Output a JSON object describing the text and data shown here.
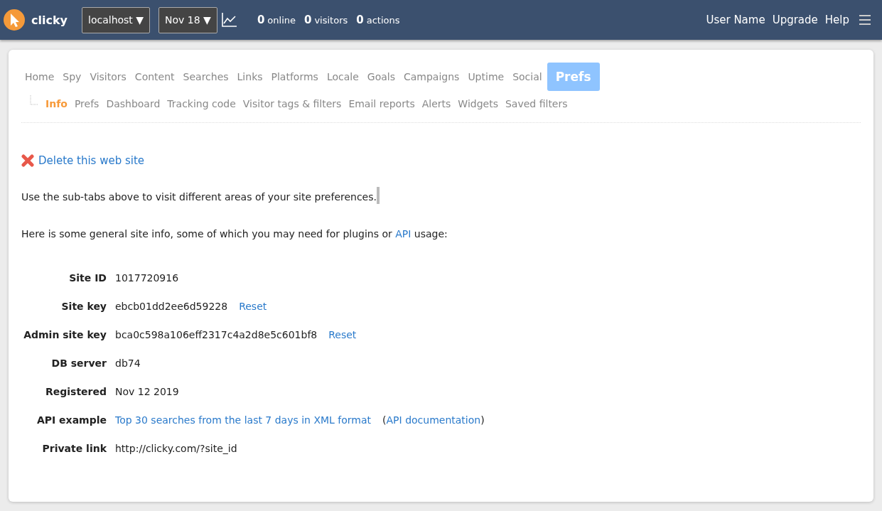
{
  "header": {
    "brand": "clicky",
    "site_select": "localhost ▼",
    "date_select": "Nov 18 ▼",
    "stats": [
      {
        "count": "0",
        "label": "online"
      },
      {
        "count": "0",
        "label": "visitors"
      },
      {
        "count": "0",
        "label": "actions"
      }
    ],
    "links": [
      "User Name",
      "Upgrade",
      "Help"
    ]
  },
  "tabs": [
    {
      "label": "Home",
      "selected": false
    },
    {
      "label": "Spy",
      "selected": false
    },
    {
      "label": "Visitors",
      "selected": false
    },
    {
      "label": "Content",
      "selected": false
    },
    {
      "label": "Searches",
      "selected": false
    },
    {
      "label": "Links",
      "selected": false
    },
    {
      "label": "Platforms",
      "selected": false
    },
    {
      "label": "Locale",
      "selected": false
    },
    {
      "label": "Goals",
      "selected": false
    },
    {
      "label": "Campaigns",
      "selected": false
    },
    {
      "label": "Uptime",
      "selected": false
    },
    {
      "label": "Social",
      "selected": false
    },
    {
      "label": "Prefs",
      "selected": true
    }
  ],
  "subtabs": [
    {
      "label": "Info",
      "selected": true
    },
    {
      "label": "Prefs",
      "selected": false
    },
    {
      "label": "Dashboard",
      "selected": false
    },
    {
      "label": "Tracking code",
      "selected": false
    },
    {
      "label": "Visitor tags & filters",
      "selected": false
    },
    {
      "label": "Email reports",
      "selected": false
    },
    {
      "label": "Alerts",
      "selected": false
    },
    {
      "label": "Widgets",
      "selected": false
    },
    {
      "label": "Saved filters",
      "selected": false
    }
  ],
  "delete_link": "Delete this web site",
  "intro": "Use the sub-tabs above to visit different areas of your site preferences.",
  "info_text": {
    "before": "Here is some general site info, some of which you may need for plugins or",
    "link": "API",
    "after": "usage:"
  },
  "info_rows": [
    {
      "label": "Site ID",
      "parts": [
        {
          "kind": "text",
          "text": "1017720916"
        }
      ]
    },
    {
      "label": "Site key",
      "parts": [
        {
          "kind": "text",
          "text": "ebcb01dd2ee6d59228"
        },
        {
          "kind": "action",
          "text": "Reset"
        }
      ]
    },
    {
      "label": "Admin site key",
      "parts": [
        {
          "kind": "text",
          "text": "bca0c598a106eff2317c4a2d8e5c601bf8"
        },
        {
          "kind": "action",
          "text": "Reset"
        }
      ]
    },
    {
      "label": "DB server",
      "parts": [
        {
          "kind": "text",
          "text": "db74"
        }
      ]
    },
    {
      "label": "Registered",
      "parts": [
        {
          "kind": "text",
          "text": "Nov 12 2019"
        }
      ]
    },
    {
      "label": "API example",
      "parts": [
        {
          "kind": "link",
          "text": "Top 30 searches from the last 7 days in XML format"
        },
        {
          "kind": "note",
          "open": "(",
          "link": "API documentation",
          "close": ")"
        }
      ]
    },
    {
      "label": "Private link",
      "parts": [
        {
          "kind": "text",
          "text": "http://clicky.com/?site_id"
        }
      ]
    }
  ]
}
